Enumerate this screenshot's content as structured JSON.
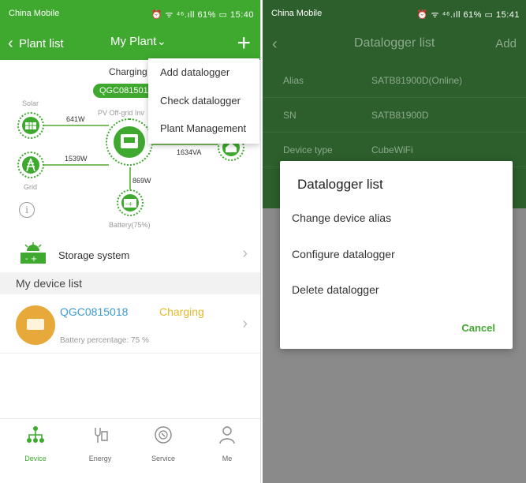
{
  "left": {
    "status": {
      "carrier": "China Mobile",
      "indicators": "⏰ ᯤ ⁴⁶.ıll 61% ▭ 15:40"
    },
    "header": {
      "back_label": "Plant list",
      "title": "My Plant",
      "add_icon": "plus-icon"
    },
    "diagram": {
      "charging": "Charging",
      "inverter_sn": "QGC0815018",
      "inverter_label": "PV Off-grid Inv",
      "solar_label": "Solar",
      "grid_label": "Grid",
      "battery_label": "Battery(75%)",
      "solar_power": "641W",
      "grid_power": "1539W",
      "load_power": "1634VA",
      "battery_power": "869W"
    },
    "menu": {
      "items": [
        "Add datalogger",
        "Check datalogger",
        "Plant Management"
      ]
    },
    "storage_row": {
      "label": "Storage system"
    },
    "device_list": {
      "heading": "My device list",
      "device": {
        "sn": "QGC0815018",
        "status": "Charging",
        "battery": "Battery percentage: 75 %"
      }
    },
    "tabs": [
      {
        "label": "Device",
        "icon": "device-icon"
      },
      {
        "label": "Energy",
        "icon": "energy-icon"
      },
      {
        "label": "Service",
        "icon": "service-icon"
      },
      {
        "label": "Me",
        "icon": "me-icon"
      }
    ],
    "colors": {
      "accent": "#3fa82f",
      "sn_blue": "#3e9bd1",
      "charging_yellow": "#e5b92b"
    }
  },
  "right": {
    "status": {
      "carrier": "China Mobile",
      "indicators": "⏰ ᯤ ⁴⁶.ıll 61% ▭ 15:41"
    },
    "header": {
      "title": "Datalogger list",
      "add": "Add"
    },
    "info": [
      {
        "key": "Alias",
        "value": "SATB81900D(Online)"
      },
      {
        "key": "SN",
        "value": "SATB81900D"
      },
      {
        "key": "Device type",
        "value": "CubeWiFi"
      }
    ],
    "dialog": {
      "title": "Datalogger list",
      "options": [
        "Change device alias",
        "Configure datalogger",
        "Delete datalogger"
      ],
      "cancel": "Cancel"
    }
  }
}
